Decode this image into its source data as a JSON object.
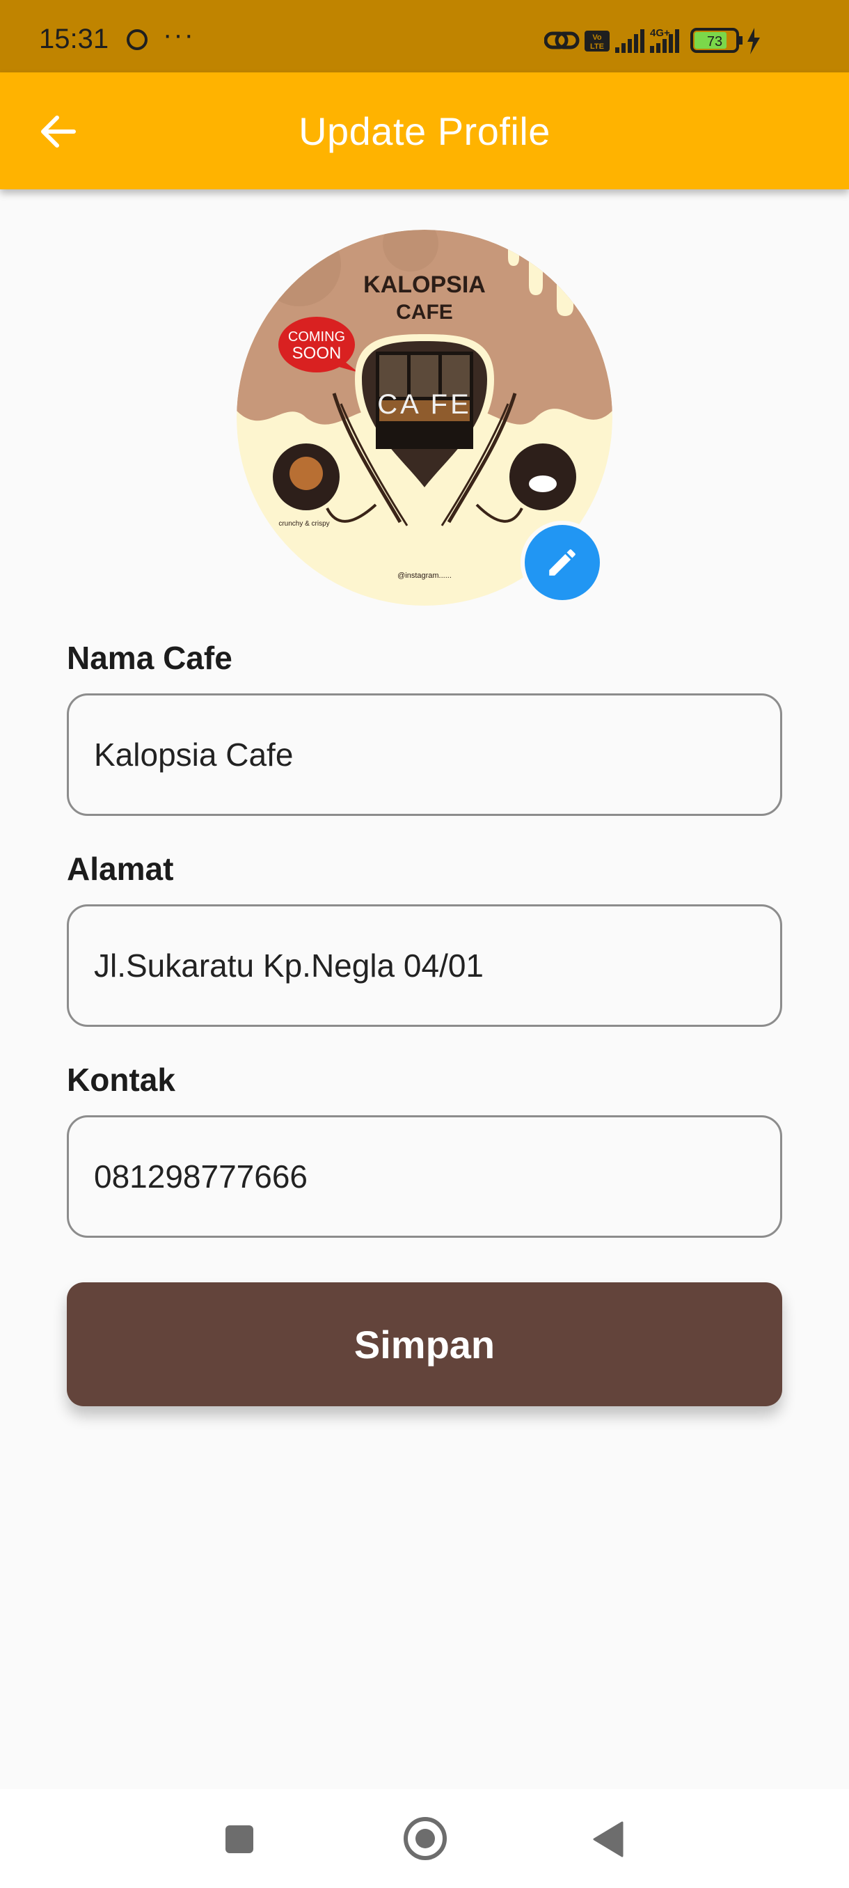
{
  "status_bar": {
    "time": "15:31",
    "dots": "···",
    "network_badge": "Vo LTE",
    "network_type": "4G+",
    "battery": "73"
  },
  "app_bar": {
    "title": "Update Profile",
    "back_icon": "arrow-left-icon"
  },
  "profile_image": {
    "title_line1": "KALOPSIA",
    "title_line2": "CAFE",
    "badge_line1": "COMING",
    "badge_line2": "SOON",
    "sign_text": "CA FE",
    "caption_left": "crunchy & crispy",
    "handle": "@instagram......",
    "edit_icon": "pencil-icon"
  },
  "form": {
    "fields": [
      {
        "label": "Nama Cafe",
        "value": "Kalopsia Cafe"
      },
      {
        "label": "Alamat",
        "value": "Jl.Sukaratu Kp.Negla 04/01"
      },
      {
        "label": "Kontak",
        "value": "081298777666"
      }
    ],
    "submit_label": "Simpan"
  },
  "nav_bar": {
    "items": [
      "recents-icon",
      "home-icon",
      "back-icon"
    ]
  },
  "colors": {
    "status_bar": "#c08400",
    "app_bar": "#ffb300",
    "edit_button": "#2196f3",
    "submit_button": "#63443b",
    "background": "#fafafa"
  }
}
